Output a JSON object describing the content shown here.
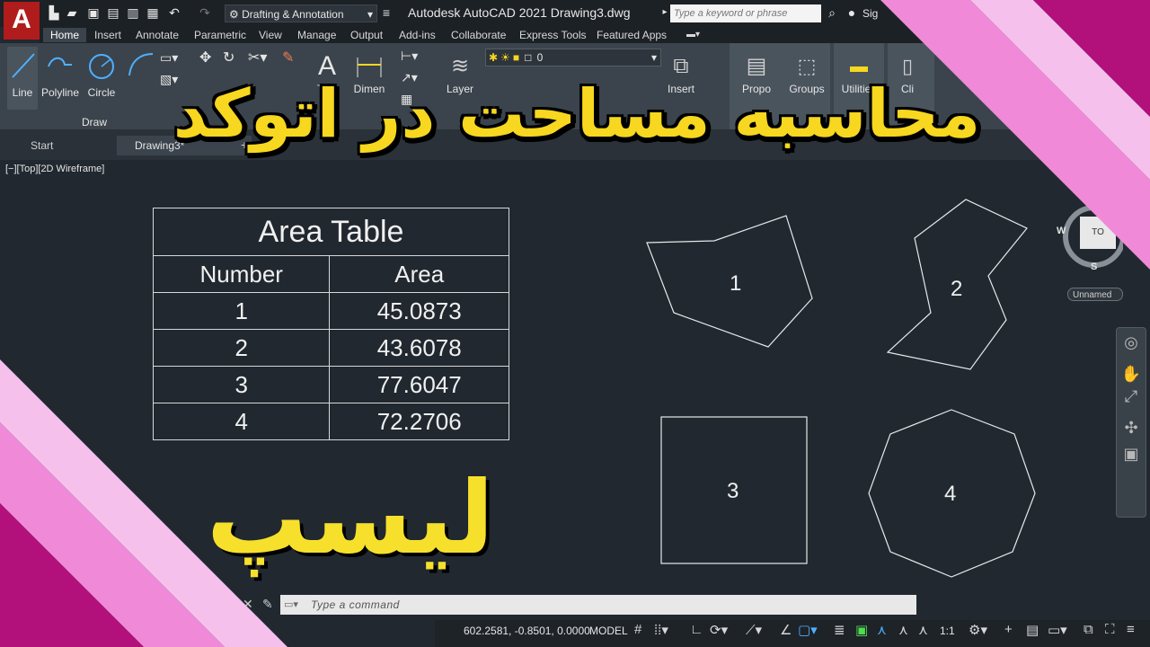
{
  "app": {
    "logo_letter": "A",
    "workspace": "Drafting & Annotation",
    "title": "Autodesk AutoCAD 2021    Drawing3.dwg",
    "search_placeholder": "Type a keyword or phrase",
    "signin": "Sig"
  },
  "ribbon": {
    "tabs": [
      "Home",
      "Insert",
      "Annotate",
      "Parametric",
      "View",
      "Manage",
      "Output",
      "Add-ins",
      "Collaborate",
      "Express Tools",
      "Featured Apps"
    ],
    "draw_tools": [
      "Line",
      "Polyline",
      "Circle"
    ],
    "draw_panel_label": "Draw",
    "text_tool": "Text",
    "dimension_tool": "Dimen",
    "layer_tool": "Layer",
    "layer_value": "0",
    "insert_tool": "Insert",
    "properties_tool": "Propo",
    "groups_tool": "Groups",
    "utilities_tool": "Utilities",
    "clipboard_tool": "Cli"
  },
  "file_tabs": {
    "start": "Start",
    "drawing": "Drawing3*",
    "add": "+"
  },
  "viewport": {
    "label": "[−][Top][2D Wireframe]"
  },
  "area_table": {
    "title": "Area Table",
    "headers": [
      "Number",
      "Area"
    ],
    "rows": [
      {
        "number": "1",
        "area": "45.0873"
      },
      {
        "number": "2",
        "area": "43.6078"
      },
      {
        "number": "3",
        "area": "77.6047"
      },
      {
        "number": "4",
        "area": "72.2706"
      }
    ]
  },
  "shapes": {
    "labels": [
      "1",
      "2",
      "3",
      "4"
    ]
  },
  "nav": {
    "west": "W",
    "south": "S",
    "cube_label": "TO",
    "named_view": "Unnamed"
  },
  "command": {
    "placeholder": "Type  a  command"
  },
  "status": {
    "coords": "602.2581, -0.8501, 0.0000",
    "space": "MODEL",
    "scale": "1:1"
  },
  "overlay": {
    "title": "محاسبه مساحت در اتوکد",
    "subtitle": "لیسپ"
  },
  "colors": {
    "accent_yellow": "#f7d71f",
    "pink_stripe": "#f08ad8",
    "magenta_stripe": "#b2107a",
    "canvas": "#212830",
    "ribbon": "#3b444c"
  }
}
